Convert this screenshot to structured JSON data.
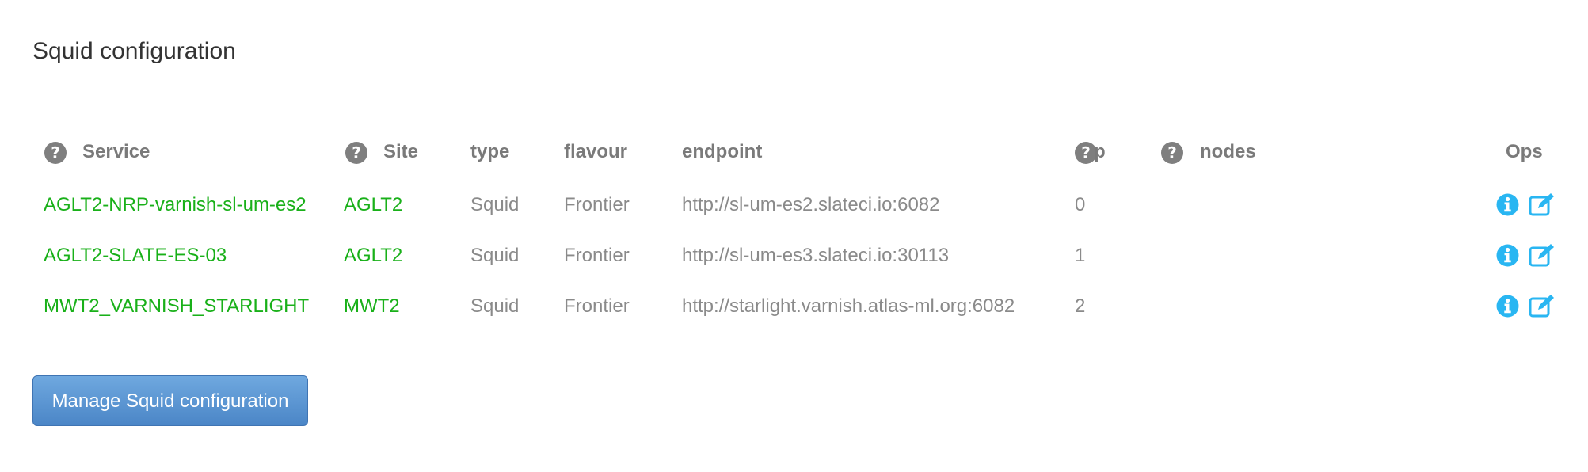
{
  "page": {
    "title": "Squid configuration"
  },
  "table": {
    "headers": {
      "service": "Service",
      "site": "Site",
      "type": "type",
      "flavour": "flavour",
      "endpoint": "endpoint",
      "p": "p",
      "nodes": "nodes",
      "ops": "Ops"
    },
    "help_icon_glyph": "?",
    "rows": [
      {
        "service": "AGLT2-NRP-varnish-sl-um-es2",
        "site": "AGLT2",
        "type": "Squid",
        "flavour": "Frontier",
        "endpoint": "http://sl-um-es2.slateci.io:6082",
        "p": "0"
      },
      {
        "service": "AGLT2-SLATE-ES-03",
        "site": "AGLT2",
        "type": "Squid",
        "flavour": "Frontier",
        "endpoint": "http://sl-um-es3.slateci.io:30113",
        "p": "1"
      },
      {
        "service": "MWT2_VARNISH_STARLIGHT",
        "site": "MWT2",
        "type": "Squid",
        "flavour": "Frontier",
        "endpoint": "http://starlight.varnish.atlas-ml.org:6082",
        "p": "2"
      }
    ],
    "ops_icons": [
      "info-circle-icon",
      "edit-icon"
    ]
  },
  "actions": {
    "manage_label": "Manage Squid configuration"
  },
  "colors": {
    "link_green": "#19b019",
    "icon_blue": "#29b6f2",
    "button_blue": "#4b86c7"
  }
}
